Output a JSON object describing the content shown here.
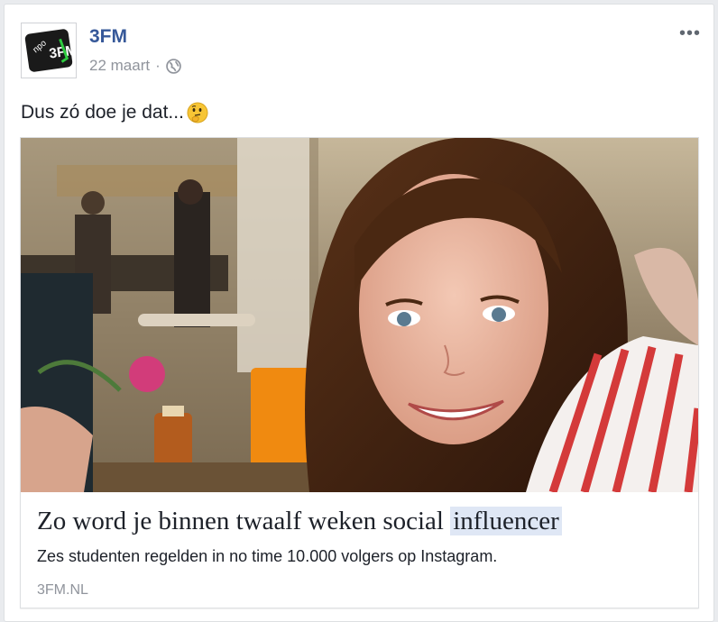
{
  "post": {
    "page_name": "3FM",
    "date": "22 maart",
    "separator": "·",
    "privacy_icon": "globe-icon",
    "more_icon": "more-options-icon",
    "more_label": "•••",
    "text": "Dus zó doe je dat...",
    "emoji_icon": "thinking-face-icon"
  },
  "avatar": {
    "logo_text_npo": "npo",
    "logo_text_3fm": "3FM",
    "colors": {
      "background": "#1a1a1a",
      "accent": "#2ecc40"
    }
  },
  "link": {
    "image_icon": "article-photo",
    "title_main": "Zo word je binnen twaalf weken social",
    "title_highlight": "influencer",
    "description": "Zes studenten regelden in no time 10.000 volgers op Instagram.",
    "domain": "3FM.NL"
  },
  "colors": {
    "brand_link": "#365899",
    "meta_gray": "#90949c",
    "text": "#1d2129",
    "highlight": "#dfe7f5"
  }
}
